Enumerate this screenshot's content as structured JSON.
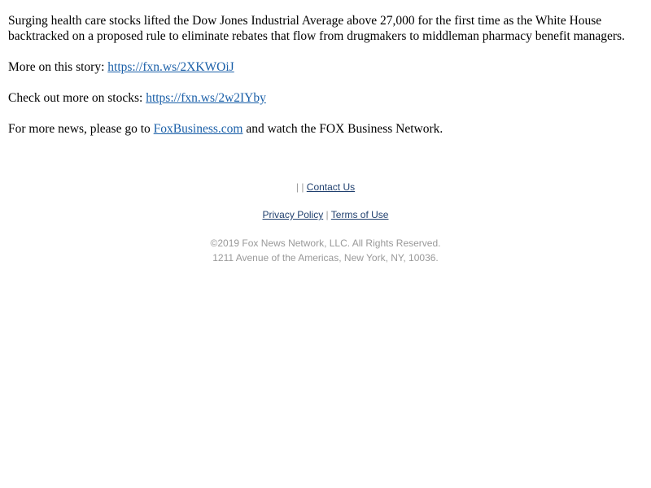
{
  "article": {
    "summary": "Surging health care stocks lifted the Dow Jones Industrial Average above 27,000 for the first time as the White House backtracked on a proposed rule to eliminate rebates that flow from drugmakers to middleman pharmacy benefit managers.",
    "story_prefix": "More on this story: ",
    "story_link": "https://fxn.ws/2XKWOiJ",
    "stocks_prefix": "Check out more on stocks: ",
    "stocks_link": "https://fxn.ws/2w2IYby",
    "news_prefix": "For more news, please go to ",
    "news_link": "FoxBusiness.com",
    "news_suffix": " and watch the FOX Business Network."
  },
  "footer": {
    "separator_1": "|",
    "separator_2": "|",
    "contact_us": "Contact Us",
    "privacy_policy": "Privacy Policy",
    "separator_3": "|",
    "terms_of_use": "Terms of Use",
    "copyright": "©2019 Fox News Network, LLC. All Rights Reserved.",
    "address": "1211 Avenue of the Americas, New York, NY, 10036."
  },
  "colors": {
    "link": "#1a5fa8",
    "footer_link": "#1f3f6e",
    "muted_text": "#999999"
  }
}
